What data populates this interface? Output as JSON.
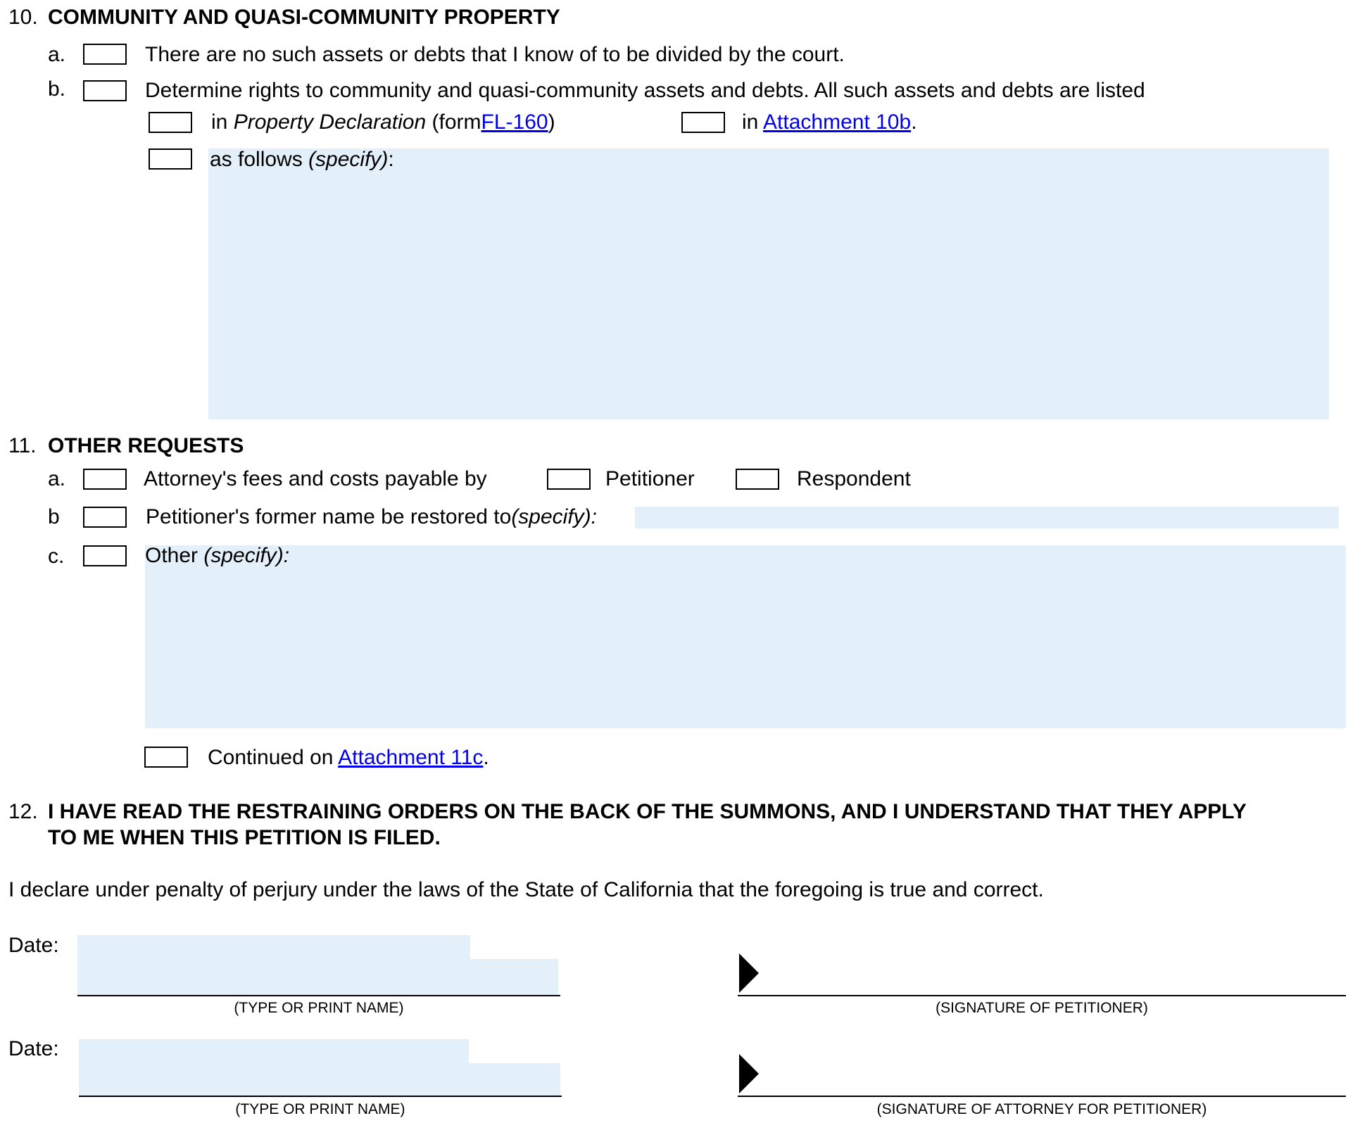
{
  "s10": {
    "number": "10.",
    "title": "COMMUNITY AND QUASI-COMMUNITY PROPERTY",
    "a_letter": "a.",
    "a_text": "There are no such assets or debts that I know of to be divided by the court.",
    "b_letter": "b.",
    "b_text": "Determine rights to community and quasi-community assets and debts. All such assets and debts are listed",
    "opt1_prefix": "in",
    "opt1_italic": "Property Declaration",
    "opt1_mid": "(form",
    "opt1_link": "FL-160",
    "opt1_close": ")",
    "opt2_prefix": "in",
    "opt2_link": "Attachment 10b",
    "opt2_period": ".",
    "opt3_prefix": "as follows",
    "opt3_italic": "(specify)",
    "opt3_colon": ":"
  },
  "s11": {
    "number": "11.",
    "title": "OTHER REQUESTS",
    "a_letter": "a.",
    "a_text": "Attorney's fees and costs payable by",
    "a_opt1": "Petitioner",
    "a_opt2": "Respondent",
    "b_letter": "b",
    "b_text": "Petitioner's former name be restored to",
    "b_italic": "(specify):",
    "c_letter": "c.",
    "c_text": "Other",
    "c_italic": "(specify):",
    "continued_prefix": "Continued on",
    "continued_link": "Attachment 11c",
    "continued_period": "."
  },
  "s12": {
    "number": "12.",
    "line1": "I HAVE READ THE RESTRAINING ORDERS ON THE BACK OF THE SUMMONS, AND I UNDERSTAND THAT THEY APPLY",
    "line2": "TO ME WHEN THIS PETITION IS FILED."
  },
  "declaration": "I declare under penalty of perjury under the laws of the State of California that the foregoing is true and correct.",
  "sign1": {
    "date_label": "Date:",
    "name_caption": "(TYPE OR PRINT NAME)",
    "signature_caption": "(SIGNATURE OF PETITIONER)"
  },
  "sign2": {
    "date_label": "Date:",
    "name_caption": "(TYPE OR PRINT NAME)",
    "signature_caption": "(SIGNATURE OF ATTORNEY FOR PETITIONER)"
  },
  "colors": {
    "field_fill": "#e3f0fa",
    "link": "#0000ee"
  }
}
